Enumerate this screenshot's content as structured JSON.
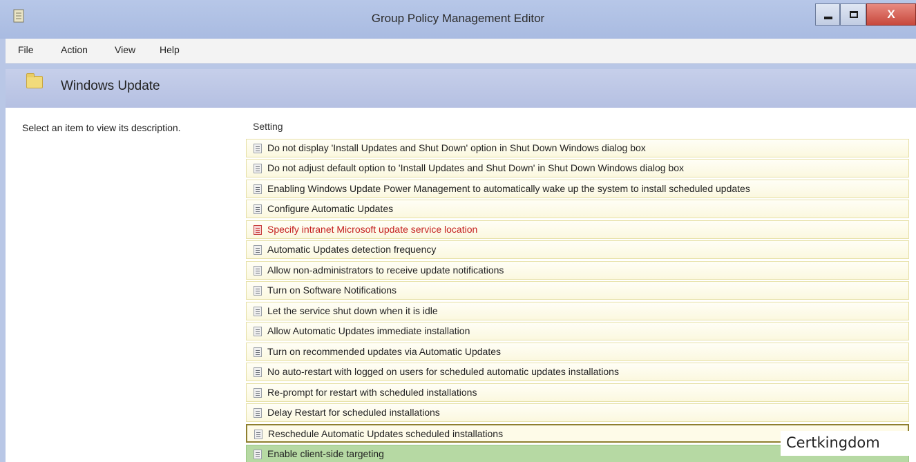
{
  "window": {
    "title": "Group Policy Management Editor",
    "minimize_label": "−",
    "close_label": "X"
  },
  "menu": [
    "File",
    "Action",
    "View",
    "Help"
  ],
  "folder": {
    "title": "Windows Update"
  },
  "description": "Select an item to view its description.",
  "list": {
    "column_header": "Setting",
    "rows": [
      "Do not display 'Install Updates and Shut Down' option in Shut Down Windows dialog box",
      "Do not adjust default option to 'Install Updates and Shut Down' in Shut Down Windows dialog box",
      "Enabling Windows Update Power Management to automatically wake up the system to install scheduled updates",
      "Configure Automatic Updates",
      "Specify intranet Microsoft update service location",
      "Automatic Updates detection frequency",
      "Allow non-administrators to receive update notifications",
      "Turn on Software Notifications",
      "Let the service shut down when it is idle",
      "Allow Automatic Updates immediate installation",
      "Turn on recommended updates via Automatic Updates",
      "No auto-restart with logged on users for scheduled automatic updates installations",
      "Re-prompt for restart with scheduled installations",
      "Delay Restart for scheduled installations",
      "Reschedule Automatic Updates scheduled installations",
      "Enable client-side targeting"
    ]
  },
  "watermark": "Certkingdom",
  "colors": {
    "titlebar": "#b7c7e8",
    "header_band": "#c6cfea",
    "row_bg": "#fbf8df",
    "highlight_red": "#c41e1e",
    "highlight_green": "#b6d9a3",
    "close_button": "#c7483c"
  },
  "icons": {
    "app": "gpo-editor-icon",
    "folder": "folder-icon",
    "setting": "policy-setting-icon"
  }
}
